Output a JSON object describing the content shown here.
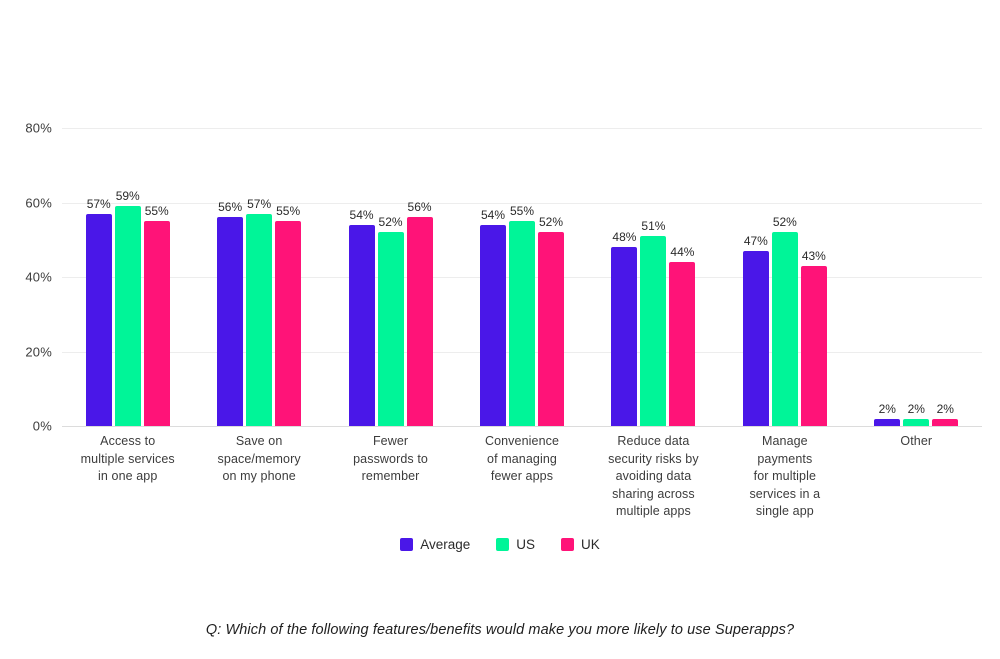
{
  "chart_data": {
    "type": "bar",
    "title": "",
    "subtitle": "",
    "xlabel": "",
    "ylabel": "",
    "ylim": [
      0,
      80
    ],
    "grid": true,
    "legend_position": "bottom",
    "ytick_labels": [
      "0%",
      "20%",
      "40%",
      "60%",
      "80%"
    ],
    "ytick_values": [
      0,
      20,
      40,
      60,
      80
    ],
    "categories": [
      "Access to\nmultiple services\nin one app",
      "Save on\nspace/memory\non my phone",
      "Fewer\npasswords to\nremember",
      "Convenience\nof managing\nfewer apps",
      "Reduce data\nsecurity risks by\navoiding data\nsharing across\nmultiple apps",
      "Manage\npayments\nfor multiple\nservices in a\nsingle app",
      "Other"
    ],
    "series": [
      {
        "name": "Average",
        "color": "#4A17E8",
        "values": [
          57,
          56,
          54,
          54,
          48,
          47,
          2
        ],
        "labels": [
          "57%",
          "56%",
          "54%",
          "54%",
          "48%",
          "47%",
          "2%"
        ]
      },
      {
        "name": "US",
        "color": "#00F598",
        "values": [
          59,
          57,
          52,
          55,
          51,
          52,
          2
        ],
        "labels": [
          "59%",
          "57%",
          "52%",
          "55%",
          "51%",
          "52%",
          "2%"
        ]
      },
      {
        "name": "UK",
        "color": "#FF1378",
        "values": [
          55,
          55,
          56,
          52,
          44,
          43,
          2
        ],
        "labels": [
          "55%",
          "55%",
          "56%",
          "52%",
          "44%",
          "43%",
          "2%"
        ]
      }
    ]
  },
  "caption": {
    "text": "Q: Which of the following features/benefits would make you more likely to use Superapps?"
  }
}
